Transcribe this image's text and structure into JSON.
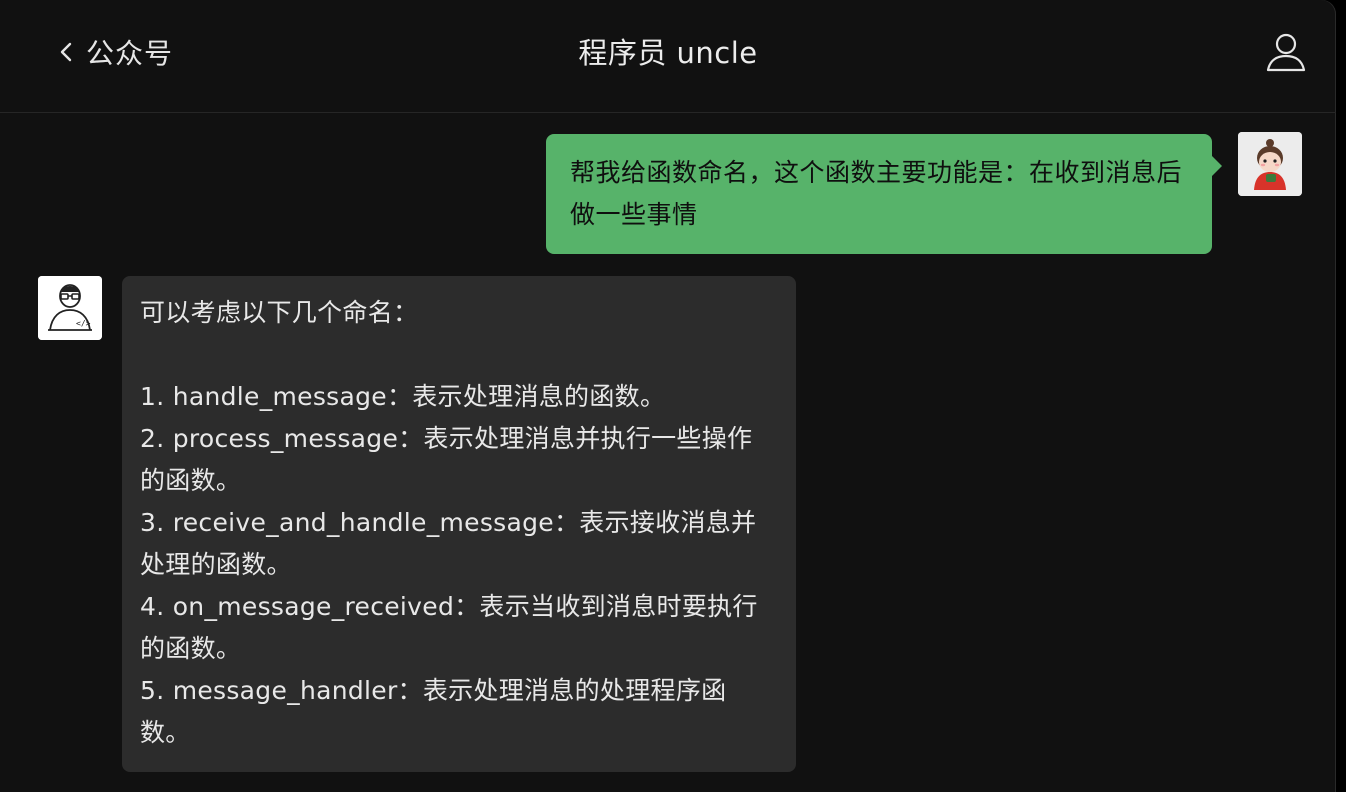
{
  "header": {
    "back_label": "公众号",
    "title": "程序员 uncle",
    "back_icon": "chevron-left-icon",
    "profile_icon": "user-profile-icon"
  },
  "messages": [
    {
      "sender": "me",
      "text": "帮我给函数命名，这个函数主要功能是：在收到消息后做一些事情"
    },
    {
      "sender": "bot",
      "intro": "可以考虑以下几个命名：",
      "items": [
        "1. handle_message：表示处理消息的函数。",
        "2. process_message：表示处理消息并执行一些操作的函数。",
        "3. receive_and_handle_message：表示接收消息并处理的函数。",
        "4. on_message_received：表示当收到消息时要执行的函数。",
        "5. message_handler：表示处理消息的处理程序函数。"
      ]
    }
  ],
  "colors": {
    "background": "#111111",
    "my_bubble": "#57b36a",
    "bot_bubble": "#2c2c2c",
    "text_light": "#e8e8e8"
  }
}
